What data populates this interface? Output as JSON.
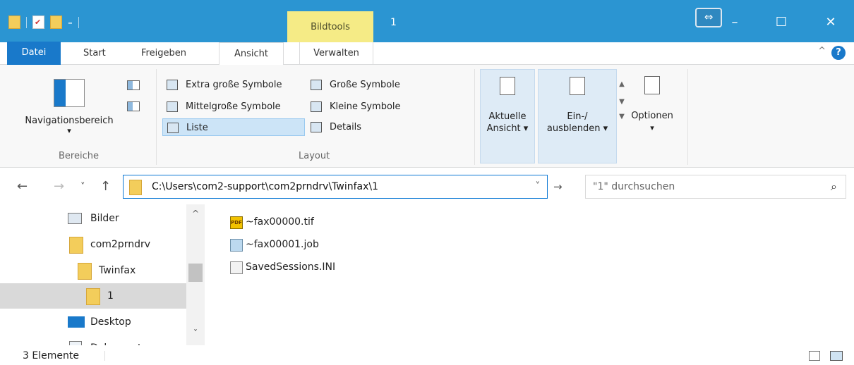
{
  "titlebar": {
    "bildtools": "Bildtools",
    "title": "1",
    "min": "–",
    "max": "☐",
    "close": "✕",
    "swap": "⇔"
  },
  "tabs": {
    "datei": "Datei",
    "start": "Start",
    "freigeben": "Freigeben",
    "ansicht": "Ansicht",
    "verwalten": "Verwalten",
    "help": "?",
    "caret": "^"
  },
  "ribbon": {
    "nav_label": "Navigationsbereich",
    "nav_arrow": "▾",
    "bereiche": "Bereiche",
    "layout_items": [
      "Extra große Symbole",
      "Große Symbole",
      "Mittelgroße Symbole",
      "Kleine Symbole",
      "Liste",
      "Details"
    ],
    "layout_label": "Layout",
    "aktuelle": "Aktuelle",
    "ansicht": "Ansicht ▾",
    "ein": "Ein-/",
    "ausblenden": "ausblenden ▾",
    "optionen": "Optionen",
    "opt_arrow": "▾"
  },
  "address": {
    "path": "C:\\Users\\com2-support\\com2prndrv\\Twinfax\\1",
    "search_placeholder": "\"1\" durchsuchen",
    "back": "←",
    "forward": "→",
    "recent": "˅",
    "up": "↑",
    "dropdown": "˅",
    "go": "→",
    "search_icon": "⌕"
  },
  "tree": {
    "items": [
      "Bilder",
      "com2prndrv",
      "Twinfax",
      "1",
      "Desktop",
      "Dokumente"
    ],
    "up": "^",
    "down": "˅"
  },
  "files": {
    "items": [
      "~fax00000.tif",
      "~fax00001.job",
      "SavedSessions.INI"
    ],
    "pdf_tag": "PDF"
  },
  "status": {
    "count": "3 Elemente"
  }
}
